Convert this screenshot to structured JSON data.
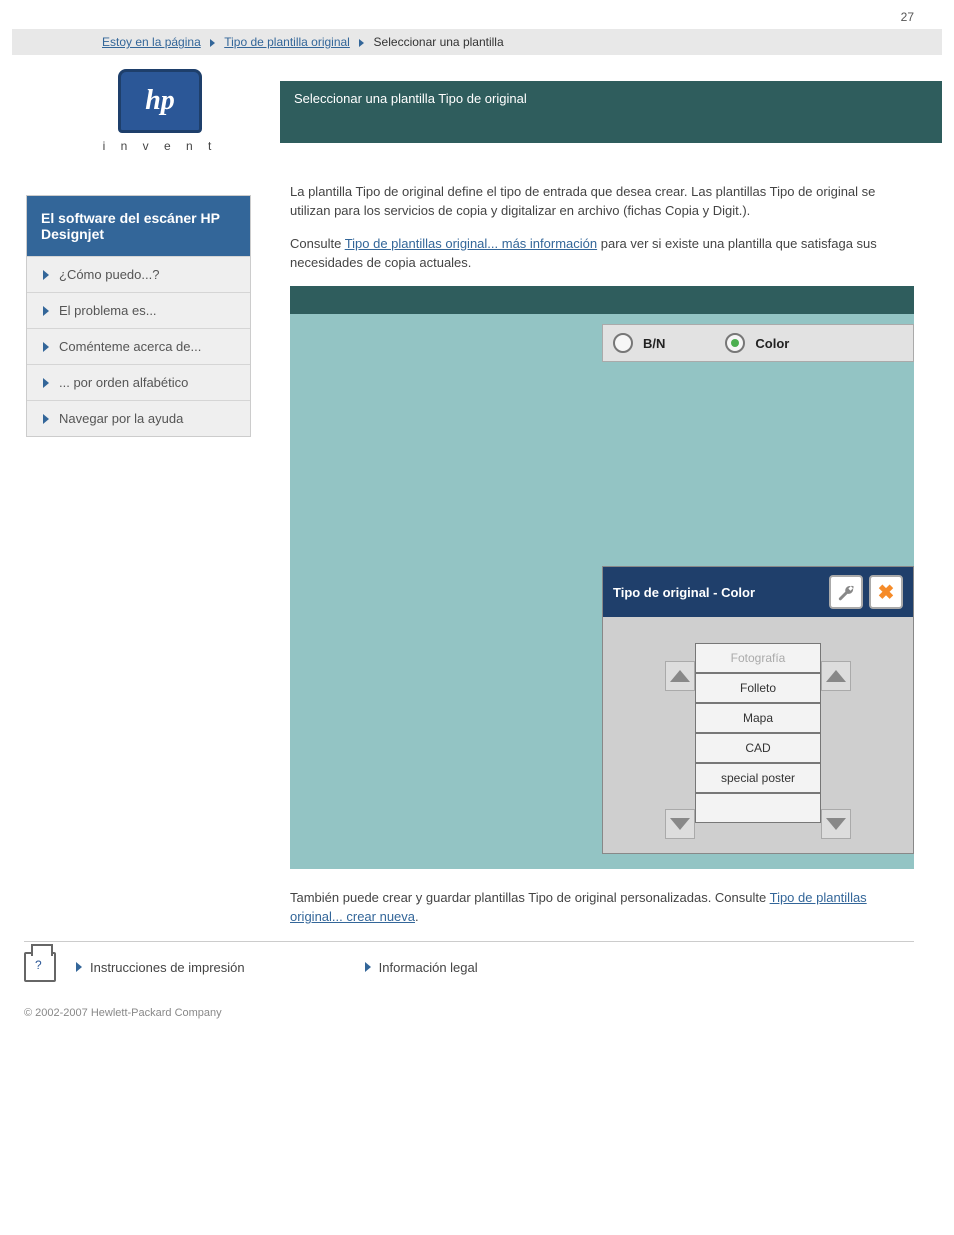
{
  "page_number": "27",
  "breadcrumb": {
    "items": [
      "Estoy en la página",
      "Tipo de plantilla original"
    ],
    "current": "Seleccionar una plantilla"
  },
  "logo_text": "hp",
  "logo_subtext": "i n v e n t",
  "page_title": "Seleccionar una plantilla Tipo de original",
  "sidebar": {
    "heading": "El software del escáner HP Designjet",
    "items": [
      {
        "label": "¿Cómo puedo...?"
      },
      {
        "label": "El problema es..."
      },
      {
        "label": "Coménteme acerca de..."
      },
      {
        "label": "... por orden alfabético"
      },
      {
        "label": "Navegar por la ayuda"
      }
    ]
  },
  "intro": "La plantilla Tipo de original define el tipo de entrada que desea crear. Las plantillas Tipo de original se utilizan para los servicios de copia y digitalizar en archivo (fichas Copia y Digit.).",
  "para_link_prefix": "Consulte ",
  "para_link_text": "Tipo de plantillas original... más información",
  "para_link_suffix": " para ver si existe una plantilla que satisfaga sus necesidades de copia actuales.",
  "screenshot": {
    "bn_label": "B/N",
    "color_label": "Color",
    "popup_title": "Tipo de original - Color",
    "list": [
      {
        "label": "Fotografía",
        "dim": true
      },
      {
        "label": "Folleto"
      },
      {
        "label": "Mapa"
      },
      {
        "label": "CAD"
      },
      {
        "label": "special poster"
      }
    ]
  },
  "outro_prefix": "También puede crear y guardar plantillas Tipo de original personalizadas. Consulte ",
  "outro_link": "Tipo de plantillas original... crear nueva",
  "footer": {
    "print": "Instrucciones de impresión",
    "legal": "Información legal"
  },
  "copyright": "© 2002-2007 Hewlett-Packard Company"
}
